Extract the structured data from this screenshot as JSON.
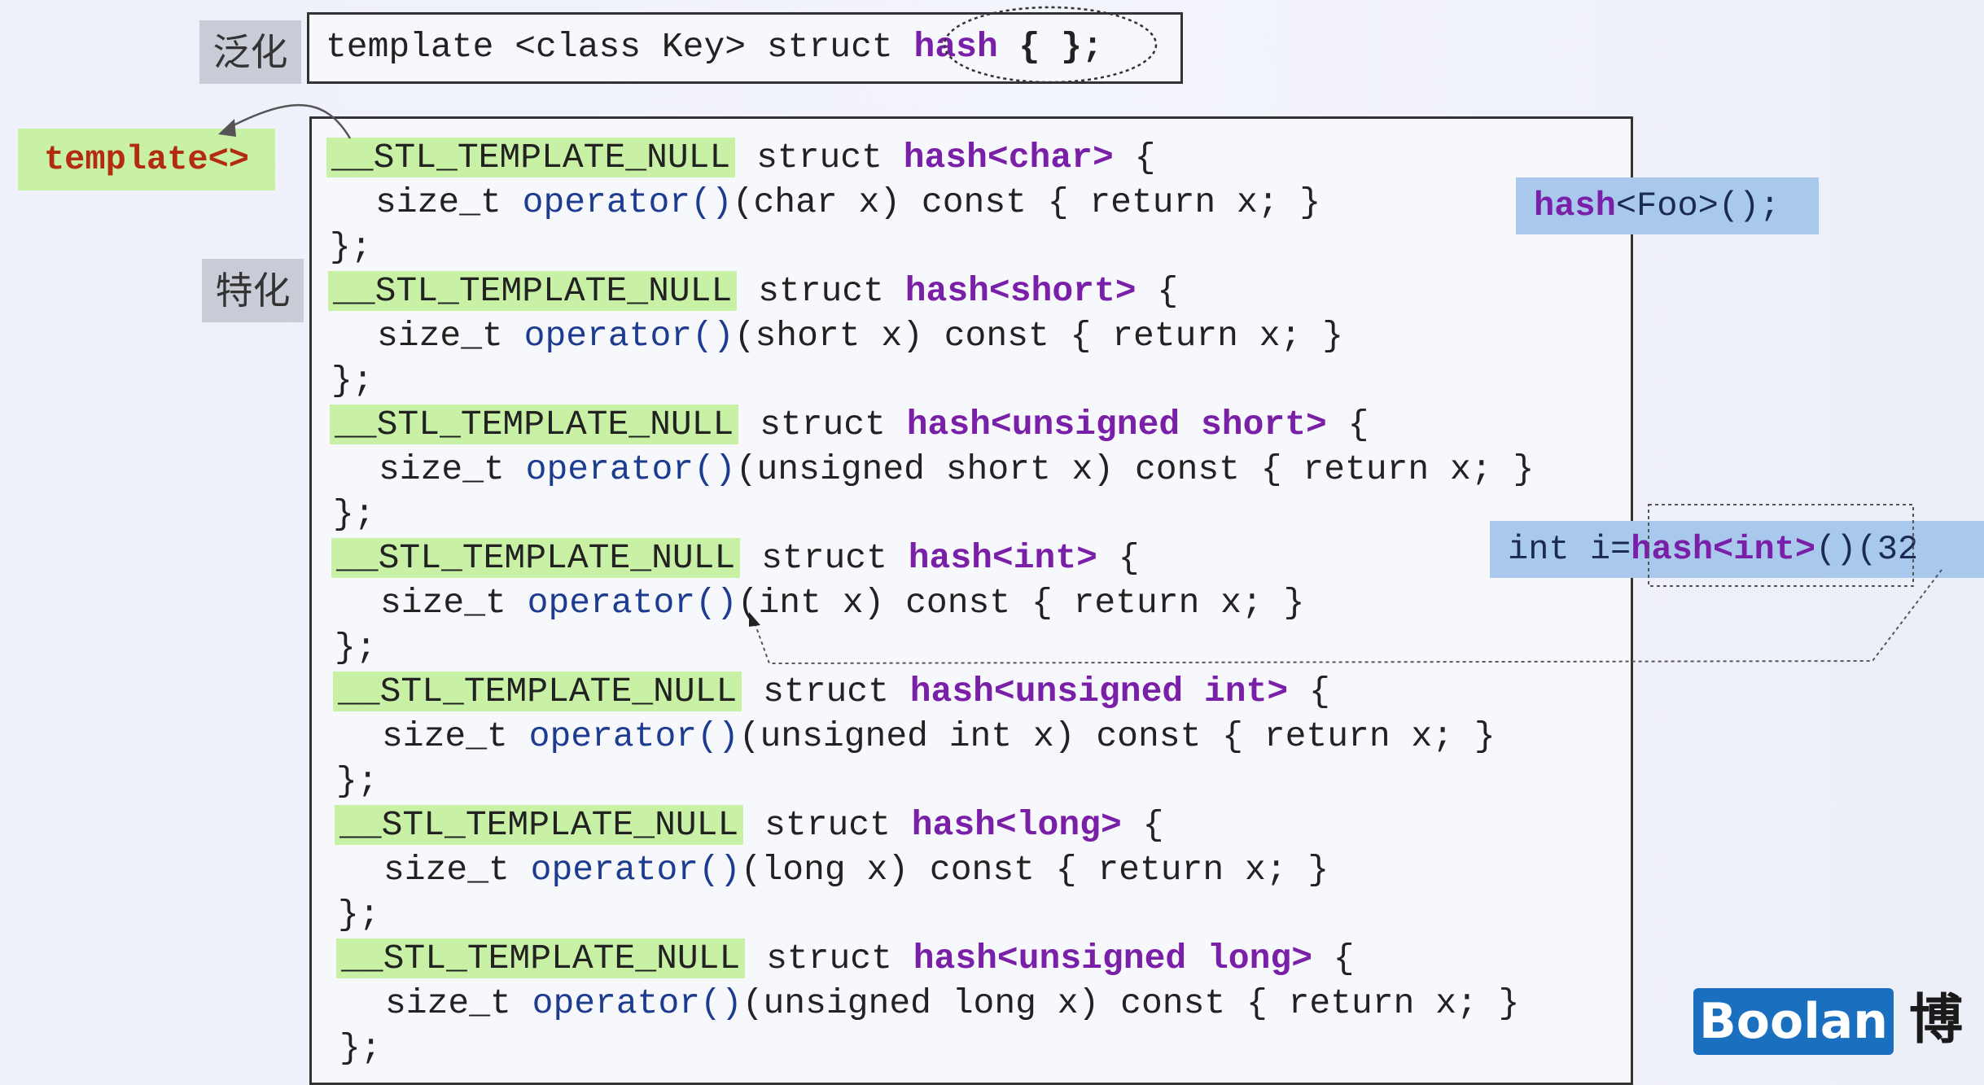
{
  "labels": {
    "generalization": "泛化",
    "specialization": "特化",
    "template_tag": "template<>"
  },
  "header_code": {
    "prefix": "template <class Key> struct ",
    "name": "hash",
    "suffix": " { };"
  },
  "specializations": [
    {
      "macro": "__STL_TEMPLATE_NULL",
      "struct": " struct ",
      "name": "hash<char>",
      "open": " {",
      "body_prefix": "size_t ",
      "body_op": "operator()",
      "body_rest": "(char x) const { return x; }",
      "close": "};"
    },
    {
      "macro": "__STL_TEMPLATE_NULL",
      "struct": " struct ",
      "name": "hash<short>",
      "open": " {",
      "body_prefix": "size_t ",
      "body_op": "operator()",
      "body_rest": "(short x) const { return x; }",
      "close": "};"
    },
    {
      "macro": "__STL_TEMPLATE_NULL",
      "struct": " struct ",
      "name": "hash<unsigned short>",
      "open": " {",
      "body_prefix": "size_t ",
      "body_op": "operator()",
      "body_rest": "(unsigned short x) const { return x; }",
      "close": "};"
    },
    {
      "macro": "__STL_TEMPLATE_NULL",
      "struct": " struct ",
      "name": "hash<int>",
      "open": " {",
      "body_prefix": "size_t ",
      "body_op": "operator()",
      "body_rest": "(int x) const { return x; }",
      "close": "};"
    },
    {
      "macro": "__STL_TEMPLATE_NULL",
      "struct": " struct ",
      "name": "hash<unsigned int>",
      "open": " {",
      "body_prefix": "size_t ",
      "body_op": "operator()",
      "body_rest": "(unsigned int x) const { return x; }",
      "close": "};"
    },
    {
      "macro": "__STL_TEMPLATE_NULL",
      "struct": " struct ",
      "name": "hash<long>",
      "open": " {",
      "body_prefix": "size_t ",
      "body_op": "operator()",
      "body_rest": "(long x) const { return x; }",
      "close": "};"
    },
    {
      "macro": "__STL_TEMPLATE_NULL",
      "struct": " struct ",
      "name": "hash<unsigned long>",
      "open": " {",
      "body_prefix": "size_t ",
      "body_op": "operator()",
      "body_rest": "(unsigned long x) const { return x; }",
      "close": "};"
    }
  ],
  "callout_foo": {
    "name": "hash",
    "rest": "<Foo>();"
  },
  "callout_int": {
    "prefix": "int i=",
    "name": "hash<int>",
    "rest": "()(32"
  },
  "brand": {
    "logo": "Boolan",
    "suffix": "博"
  },
  "colors": {
    "keyword": "#7a1fa8",
    "operator": "#1d3b8f",
    "macro_highlight": "#c9f1a6",
    "template_text": "#b32b10",
    "callout": "#a8c8ec",
    "brand": "#1a6fbf"
  }
}
